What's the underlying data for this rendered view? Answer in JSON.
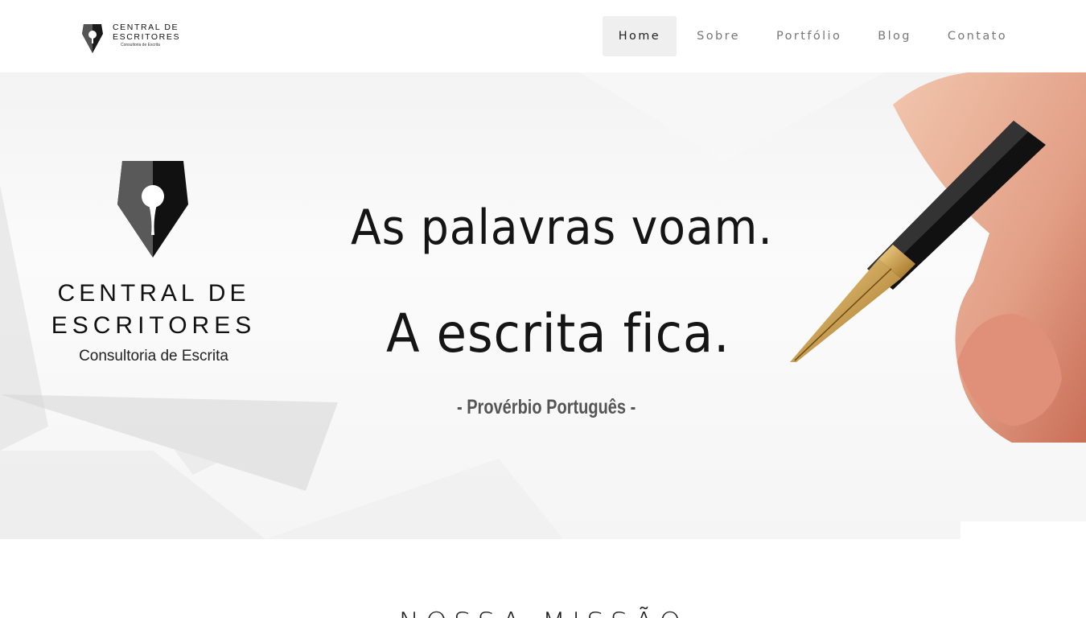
{
  "brand": {
    "line1": "CENTRAL DE",
    "line2": "ESCRITORES",
    "tagline": "Consultoria de Escrita"
  },
  "nav": {
    "items": [
      {
        "label": "Home",
        "active": true
      },
      {
        "label": "Sobre",
        "active": false
      },
      {
        "label": "Portfólio",
        "active": false
      },
      {
        "label": "Blog",
        "active": false
      },
      {
        "label": "Contato",
        "active": false
      }
    ]
  },
  "hero": {
    "quote_line1": "As palavras voam.",
    "quote_line2": "A escrita fica.",
    "attribution": "- Provérbio Português -"
  },
  "section": {
    "title": "NOSSA MISSÃO"
  },
  "colors": {
    "accent_text": "#222222",
    "nav_text": "#777777",
    "nav_active_bg": "#efefef"
  },
  "icons": [
    "pen-nib-logo-icon",
    "fountain-pen-icon"
  ]
}
